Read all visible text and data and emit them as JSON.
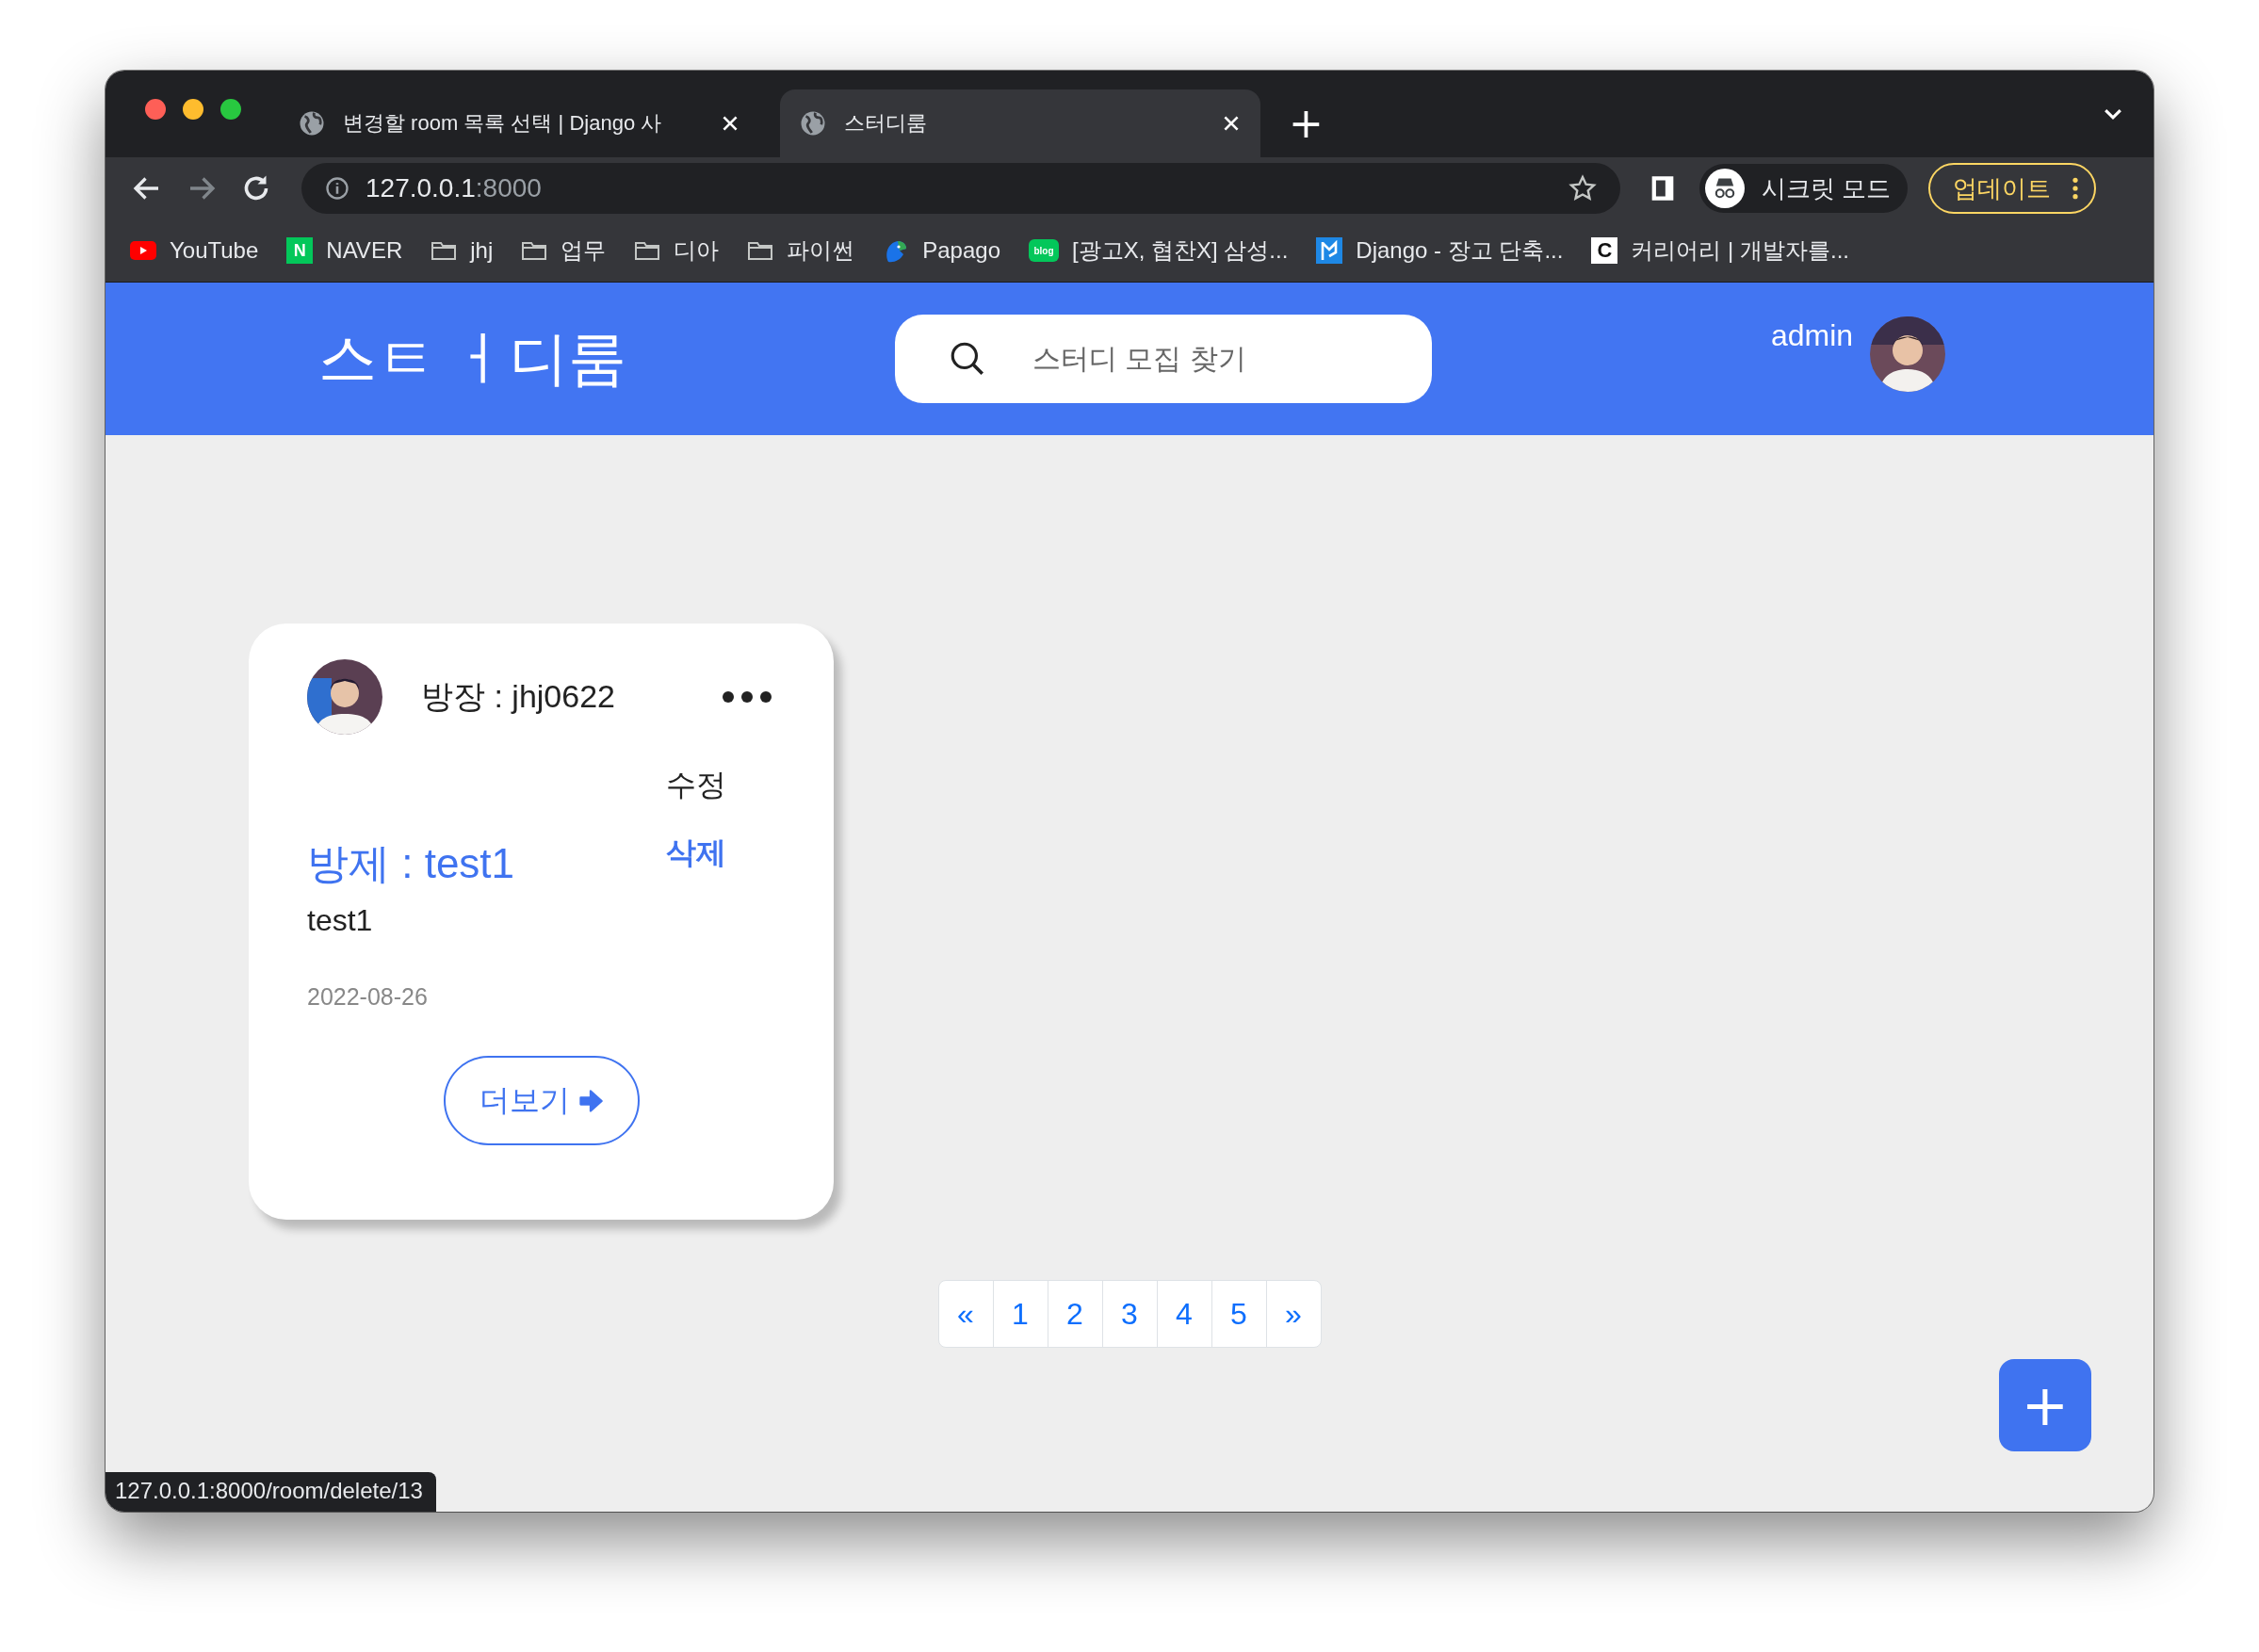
{
  "browser": {
    "tabs": [
      {
        "title": "변경할 room 목록 선택 | Django 사",
        "selected": false
      },
      {
        "title": "스터디룸",
        "selected": true
      }
    ],
    "new_tab": "+",
    "address": {
      "host": "127.0.0.1",
      "port": ":8000"
    },
    "incognito_label": "시크릿 모드",
    "update_label": "업데이트",
    "bookmarks": [
      {
        "label": "YouTube",
        "kind": "play"
      },
      {
        "label": "NAVER",
        "kind": "badge",
        "badge": "N"
      },
      {
        "label": "jhj",
        "kind": "folder"
      },
      {
        "label": "업무",
        "kind": "folder"
      },
      {
        "label": "디아",
        "kind": "folder"
      },
      {
        "label": "파이썬",
        "kind": "folder"
      },
      {
        "label": "Papago",
        "kind": "bird"
      },
      {
        "label": "[광고X, 협찬X] 삼성...",
        "kind": "blog",
        "badge": "blog"
      },
      {
        "label": "Django - 장고 단축...",
        "kind": "flag"
      },
      {
        "label": "커리어리 | 개발자를...",
        "kind": "letter",
        "badge": "C"
      }
    ],
    "status_url": "127.0.0.1:8000/room/delete/13"
  },
  "header": {
    "logo": "스ㅌ ㅓ디룸",
    "search": {
      "placeholder": "스터디 모집 찾기"
    },
    "user": "admin"
  },
  "cards": [
    {
      "owner": "방장 : jhj0622",
      "menu": [
        {
          "label": "수정",
          "highlighted": false
        },
        {
          "label": "삭제",
          "highlighted": true
        }
      ],
      "title": "방제 : test1",
      "description": "test1",
      "date": "2022-08-26",
      "more_label": "더보기"
    }
  ],
  "pagination": [
    "«",
    "1",
    "2",
    "3",
    "4",
    "5",
    "»"
  ],
  "add_button": "+"
}
